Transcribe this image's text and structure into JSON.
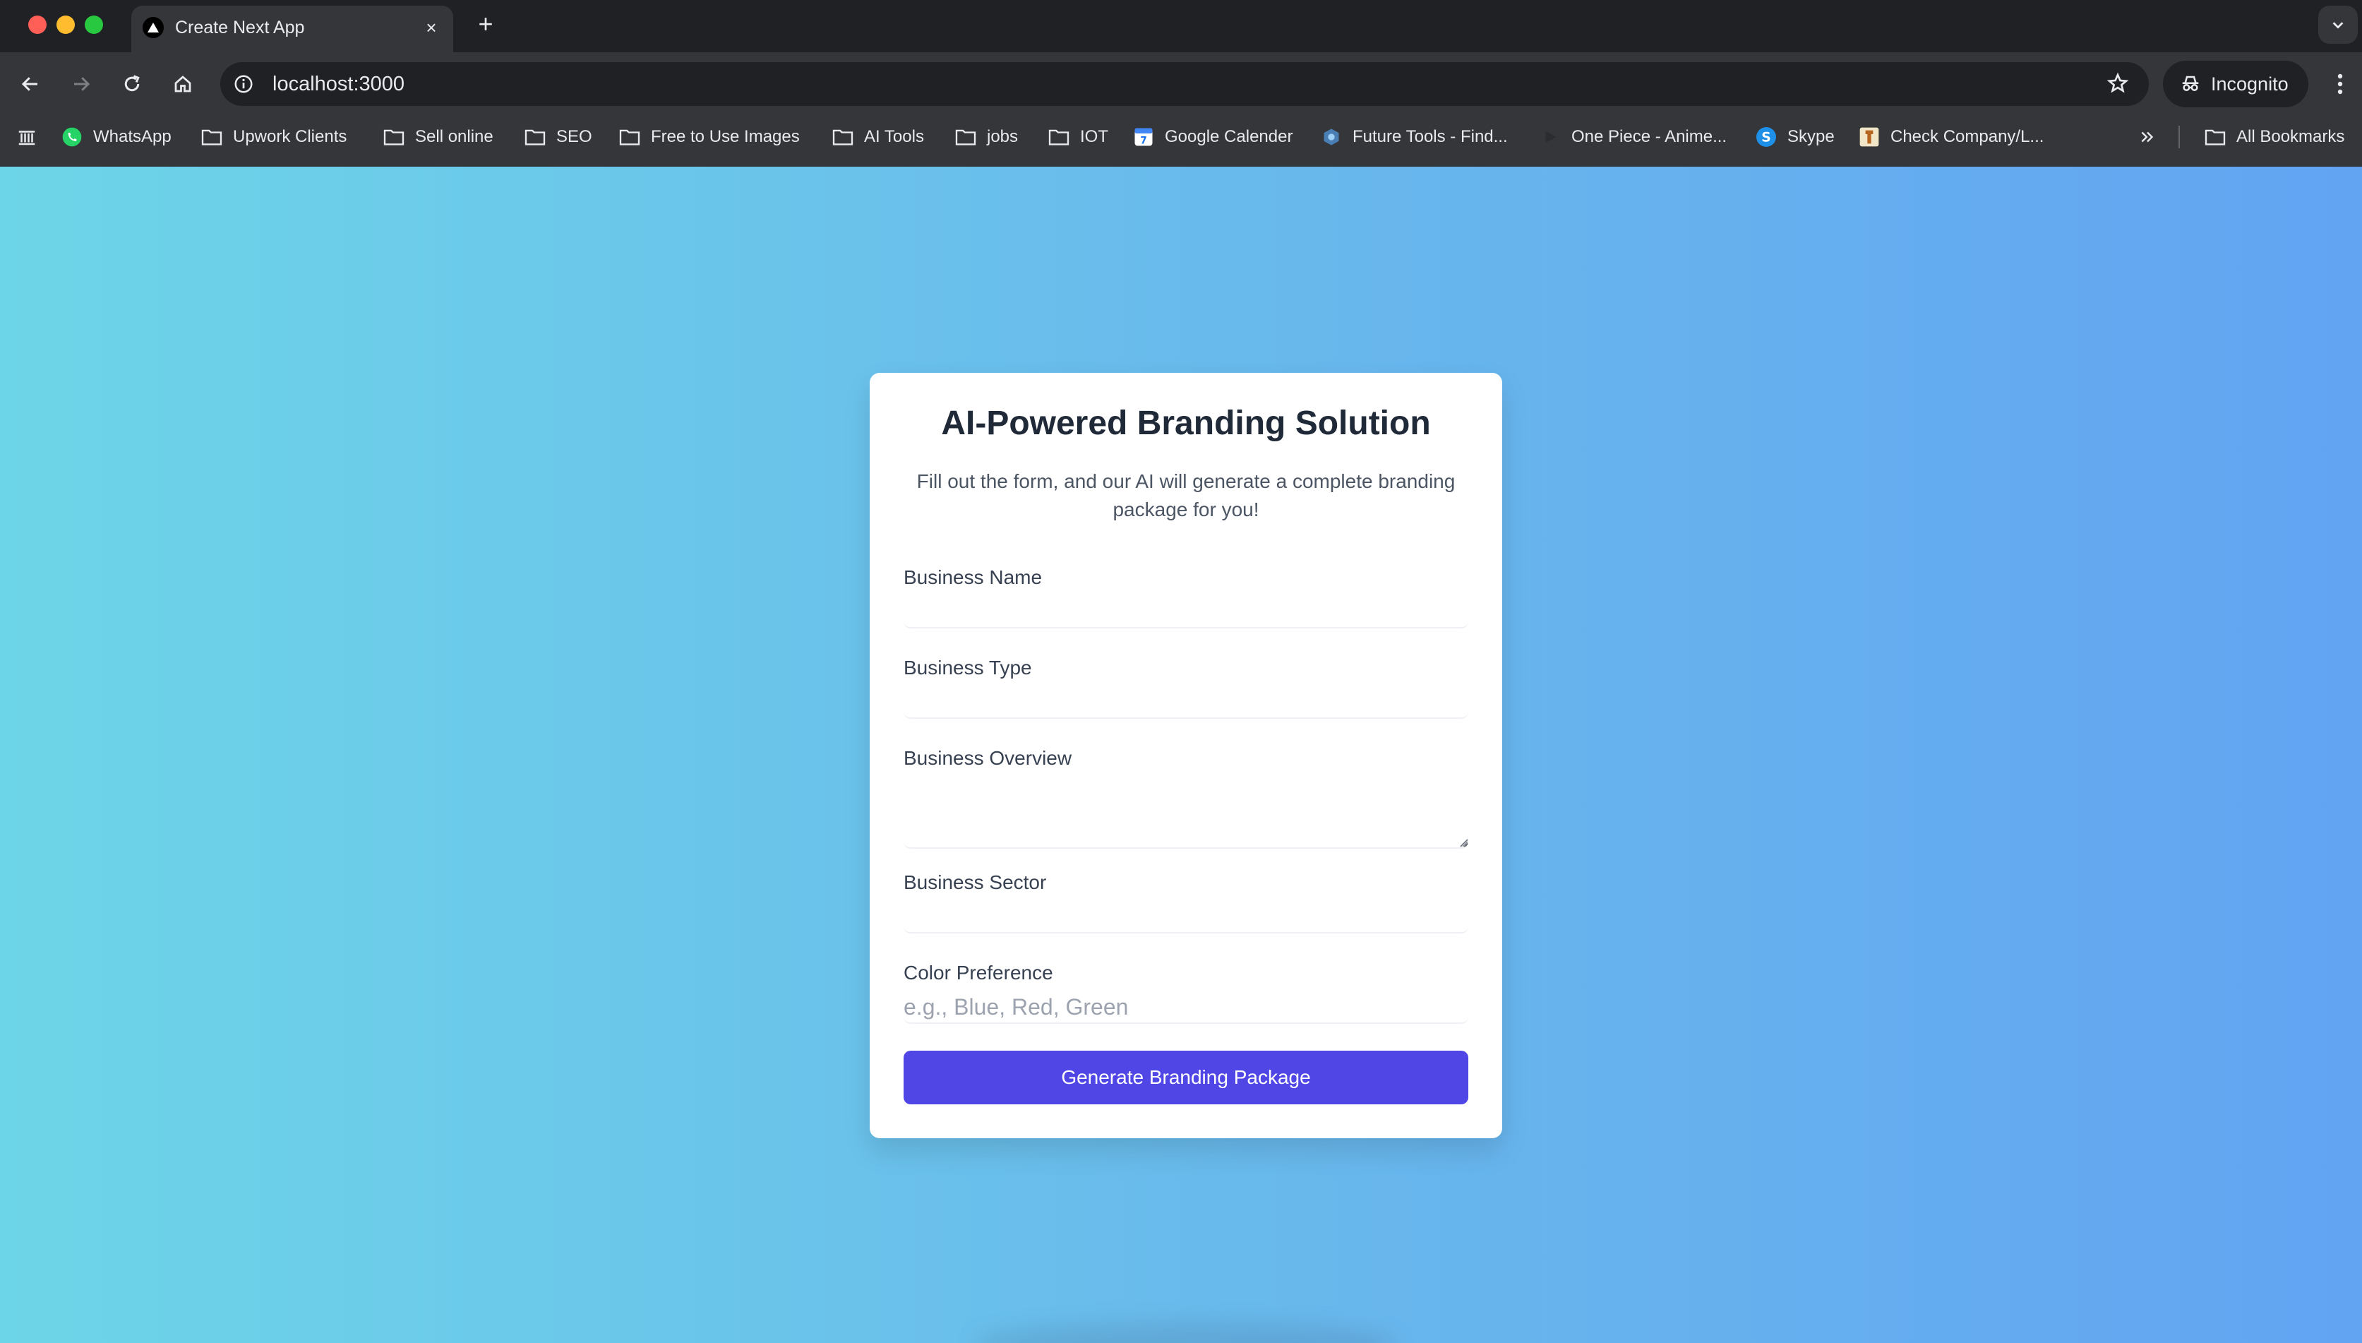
{
  "browser": {
    "tab_title": "Create Next App",
    "tab_close": "×",
    "new_tab": "+",
    "url": "localhost:3000",
    "incognito_label": "Incognito"
  },
  "bookmarks": [
    {
      "label": "WhatsApp",
      "icon": "whatsapp-icon"
    },
    {
      "label": "Upwork Clients",
      "icon": "folder-icon"
    },
    {
      "label": "Sell online",
      "icon": "folder-icon"
    },
    {
      "label": "SEO",
      "icon": "folder-icon"
    },
    {
      "label": "Free to Use Images",
      "icon": "folder-icon"
    },
    {
      "label": "AI Tools",
      "icon": "folder-icon"
    },
    {
      "label": "jobs",
      "icon": "folder-icon"
    },
    {
      "label": "IOT",
      "icon": "folder-icon"
    },
    {
      "label": "Google Calender",
      "icon": "calendar-icon"
    },
    {
      "label": "Future Tools - Find...",
      "icon": "future-tools-icon"
    },
    {
      "label": "One Piece - Anime...",
      "icon": "play-icon"
    },
    {
      "label": "Skype",
      "icon": "skype-icon"
    },
    {
      "label": "Check Company/L...",
      "icon": "emblem-icon"
    }
  ],
  "all_bookmarks_label": "All Bookmarks",
  "form": {
    "title": "AI-Powered Branding Solution",
    "description": "Fill out the form, and our AI will generate a complete branding package for you!",
    "business_name_label": "Business Name",
    "business_name_value": "",
    "business_type_label": "Business Type",
    "business_type_value": "",
    "business_overview_label": "Business Overview",
    "business_overview_value": "",
    "business_sector_label": "Business Sector",
    "business_sector_value": "",
    "color_preference_label": "Color Preference",
    "color_preference_placeholder": "e.g., Blue, Red, Green",
    "submit_label": "Generate Branding Package"
  },
  "colors": {
    "accent": "#4f46e5",
    "gradient_start": "#6dd5e8",
    "gradient_end": "#62a4f2"
  }
}
